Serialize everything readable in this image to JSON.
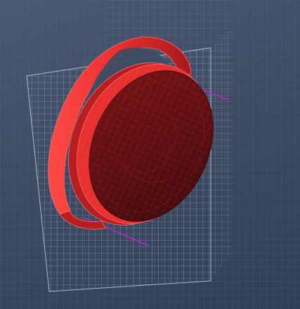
{
  "viewport": {
    "background_top": "#4a5873",
    "background_bottom": "#323e55",
    "grid_color": "#7f8ea8",
    "grid_highlight_color": "#b8c4d8",
    "axis_color": "#c21fd1"
  },
  "model": {
    "shape": "disc-with-handle",
    "body_color": "#5a0d0f",
    "rim_color": "#e8302f",
    "rim_shadow_color": "#b81e20",
    "mesh_color": "#ff6b6b"
  }
}
